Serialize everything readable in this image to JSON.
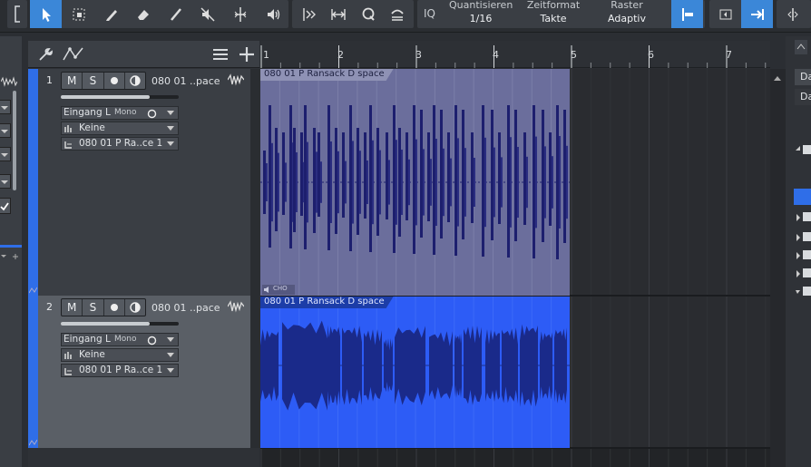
{
  "toolbar": {
    "quantize": {
      "label": "Quantisieren",
      "value": "1/16"
    },
    "timebase": {
      "label": "Zeitformat",
      "value": "Takte"
    },
    "snap": {
      "label": "Raster",
      "value": "Adaptiv"
    },
    "iq_label": "IQ"
  },
  "ruler": {
    "marks": [
      "1",
      "2",
      "3",
      "4",
      "5",
      "6",
      "7"
    ]
  },
  "tracks": [
    {
      "number": "1",
      "mute": "M",
      "solo": "S",
      "name": "080 01 ..pace",
      "input": "Eingang L",
      "input_mode": "Mono",
      "output": "Keine",
      "instrument": "080 01 P Ra..ce 1",
      "volume_fraction": 0.75
    },
    {
      "number": "2",
      "mute": "M",
      "solo": "S",
      "name": "080 01 ..pace",
      "input": "Eingang L",
      "input_mode": "Mono",
      "output": "Keine",
      "instrument": "080 01 P Ra..ce 1",
      "volume_fraction": 0.75
    }
  ],
  "clips": [
    {
      "name": "080 01 P Ransack D space",
      "color": "#6b6e9c",
      "footer": "CHO"
    },
    {
      "name": "080 01 P Ransack D space",
      "color": "#2d5cf6"
    }
  ],
  "right_panel": {
    "items": [
      "Da",
      "Da"
    ]
  },
  "colors": {
    "accent": "#3b87d8",
    "track_strip": "#2f6ee8",
    "clip_selected": "#2d5cf6",
    "clip_idle": "#6b6e9c"
  }
}
